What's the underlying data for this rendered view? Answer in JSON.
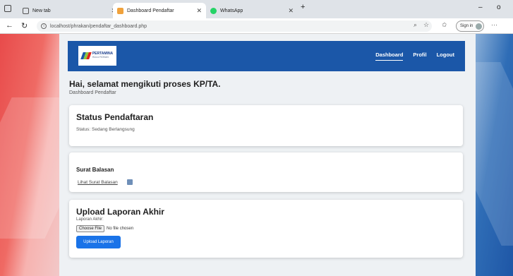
{
  "browser": {
    "tabs": [
      {
        "title": "New tab"
      },
      {
        "title": "Dashboard Pendaftar",
        "active": true
      },
      {
        "title": "WhatsApp"
      }
    ],
    "new_tab": "+",
    "url": "localhost/phrakan/pendaftar_dashboard.php",
    "signin_label": "Sign in",
    "minimize": "–",
    "close_window": "o"
  },
  "navbar": {
    "logo_text": "PERTAMINA",
    "logo_subtext": "HULU ROKAN",
    "links": [
      "Dashboard",
      "Profil",
      "Logout"
    ]
  },
  "greeting": {
    "title": "Hai, selamat mengikuti proses KP/TA.",
    "subtitle": "Dashboard Pendaftar"
  },
  "status_card": {
    "title": "Status Pendaftaran",
    "status_text": "Status: Sedang Berlangsung"
  },
  "reply_card": {
    "title": "Surat Balasan",
    "link": "Lihat Surat Balasan"
  },
  "upload_card": {
    "title": "Upload Laporan Akhir",
    "field_label": "Laporan Akhir:",
    "choose_file": "Choose File",
    "no_file": "No file chosen",
    "submit": "Upload Laporan"
  },
  "colors": {
    "navbar": "#1b57a8",
    "primary_button": "#1a73e8",
    "brand_red": "#e84b4b"
  }
}
